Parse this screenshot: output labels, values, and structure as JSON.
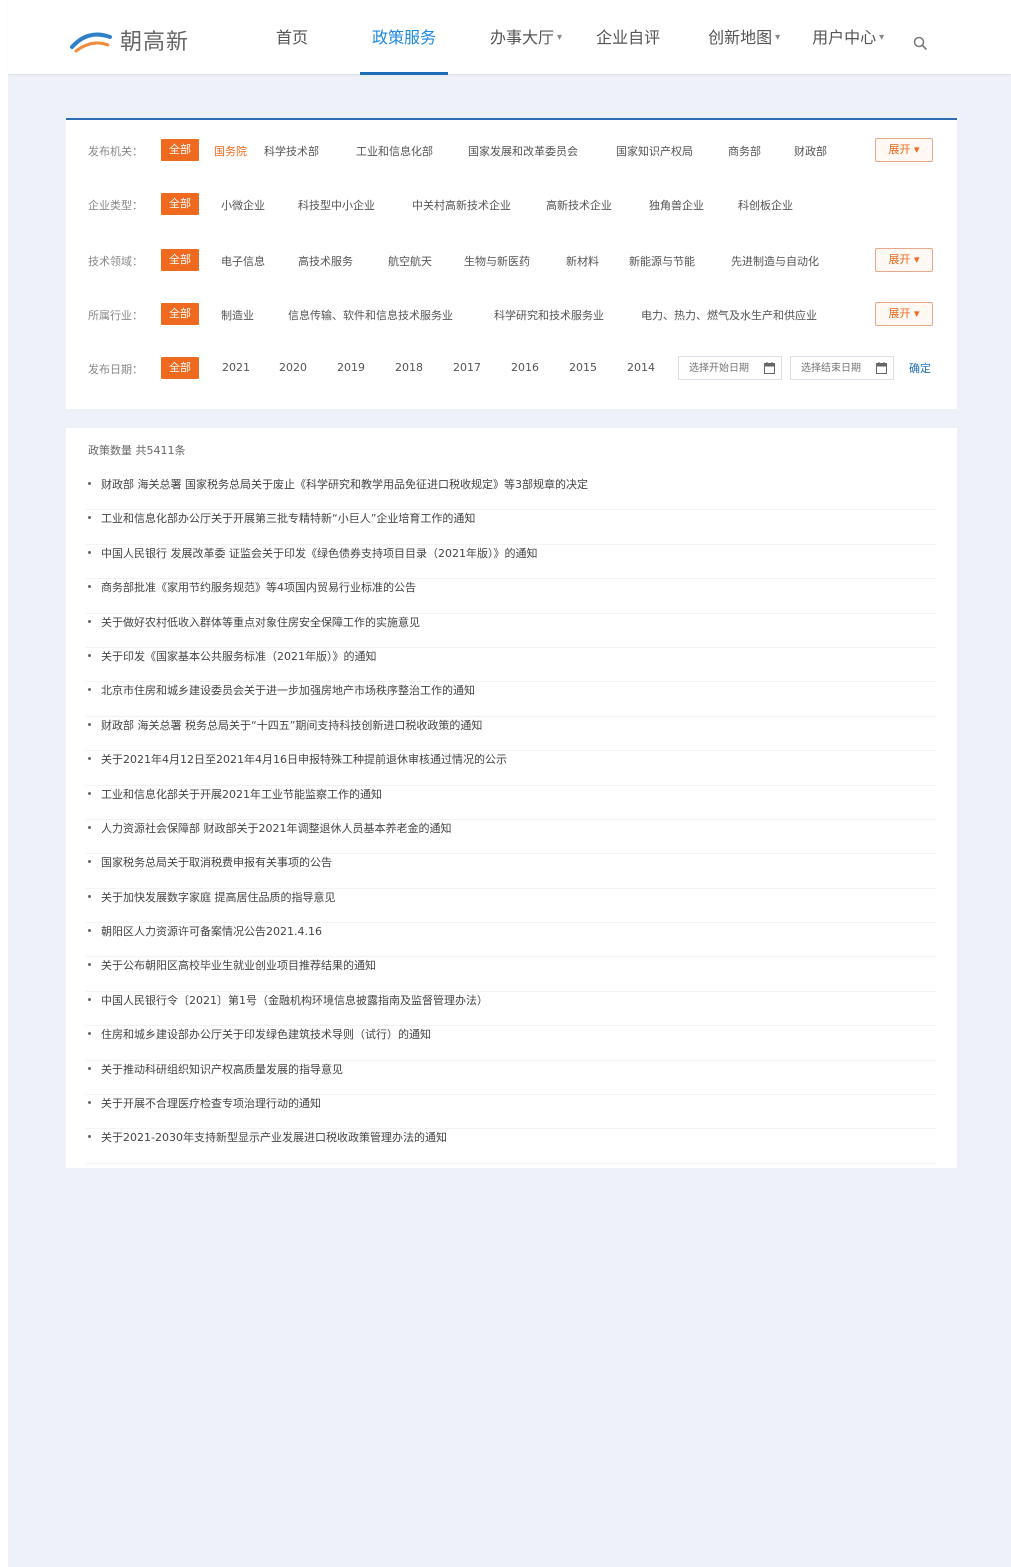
{
  "header": {
    "logo_text": "朝高新",
    "nav": [
      {
        "label": "首页",
        "has_caret": false,
        "active": false
      },
      {
        "label": "政策服务",
        "has_caret": false,
        "active": true
      },
      {
        "label": "办事大厅",
        "has_caret": true,
        "active": false
      },
      {
        "label": "企业自评",
        "has_caret": false,
        "active": false
      },
      {
        "label": "创新地图",
        "has_caret": true,
        "active": false
      },
      {
        "label": "用户中心",
        "has_caret": true,
        "active": false
      }
    ],
    "caret": "▾",
    "search_icon": "search-icon"
  },
  "filters": {
    "all_label": "全部",
    "more_label": "展开 ▾",
    "confirm_label": "确定",
    "rows": [
      {
        "label": "发布机关：",
        "options": [
          "国务院",
          "科学技术部",
          "工业和信息化部",
          "国家发展和改革委员会",
          "国家知识产权局",
          "商务部",
          "财政部"
        ],
        "selected": 0,
        "has_more": true
      },
      {
        "label": "企业类型：",
        "options": [
          "小微企业",
          "科技型中小企业",
          "中关村高新技术企业",
          "高新技术企业",
          "独角兽企业",
          "科创板企业"
        ],
        "selected": -1,
        "has_more": false
      },
      {
        "label": "技术领域：",
        "options": [
          "电子信息",
          "高技术服务",
          "航空航天",
          "生物与新医药",
          "新材料",
          "新能源与节能",
          "先进制造与自动化"
        ],
        "selected": -1,
        "has_more": true
      },
      {
        "label": "所属行业：",
        "options": [
          "制造业",
          "信息传输、软件和信息技术服务业",
          "科学研究和技术服务业",
          "电力、热力、燃气及水生产和供应业"
        ],
        "selected": -1,
        "has_more": true
      },
      {
        "label": "发布日期：",
        "options": [
          "2021",
          "2020",
          "2019",
          "2018",
          "2017",
          "2016",
          "2015",
          "2014"
        ],
        "selected": -1,
        "has_more": false,
        "date_start_placeholder": "选择开始日期",
        "date_end_placeholder": "选择结束日期"
      }
    ]
  },
  "policies": {
    "count_label": "政策数量 共5411条",
    "items": [
      "财政部 海关总署 国家税务总局关于废止《科学研究和教学用品免征进口税收规定》等3部规章的决定",
      "工业和信息化部办公厅关于开展第三批专精特新“小巨人”企业培育工作的通知",
      "中国人民银行 发展改革委 证监会关于印发《绿色债券支持项目目录（2021年版）》的通知",
      "商务部批准《家用节约服务规范》等4项国内贸易行业标准的公告",
      "关于做好农村低收入群体等重点对象住房安全保障工作的实施意见",
      "关于印发《国家基本公共服务标准（2021年版）》的通知",
      "北京市住房和城乡建设委员会关于进一步加强房地产市场秩序整治工作的通知",
      "财政部 海关总署 税务总局关于“十四五”期间支持科技创新进口税收政策的通知",
      "关于2021年4月12日至2021年4月16日申报特殊工种提前退休审核通过情况的公示",
      "工业和信息化部关于开展2021年工业节能监察工作的通知",
      "人力资源社会保障部 财政部关于2021年调整退休人员基本养老金的通知",
      "国家税务总局关于取消税费申报有关事项的公告",
      "关于加快发展数字家庭 提高居住品质的指导意见",
      "朝阳区人力资源许可备案情况公告2021.4.16",
      "关于公布朝阳区高校毕业生就业创业项目推荐结果的通知",
      "中国人民银行令〔2021〕第1号（金融机构环境信息披露指南及监督管理办法）",
      "住房和城乡建设部办公厅关于印发绿色建筑技术导则（试行）的通知",
      "关于推动科研组织知识产权高质量发展的指导意见",
      "关于开展不合理医疗检查专项治理行动的通知",
      "关于2021-2030年支持新型显示产业发展进口税收政策管理办法的通知"
    ]
  },
  "colors": {
    "accent_blue": "#1e6fb8",
    "accent_orange": "#ef6a1f",
    "page_bg": "#eef1f7"
  }
}
